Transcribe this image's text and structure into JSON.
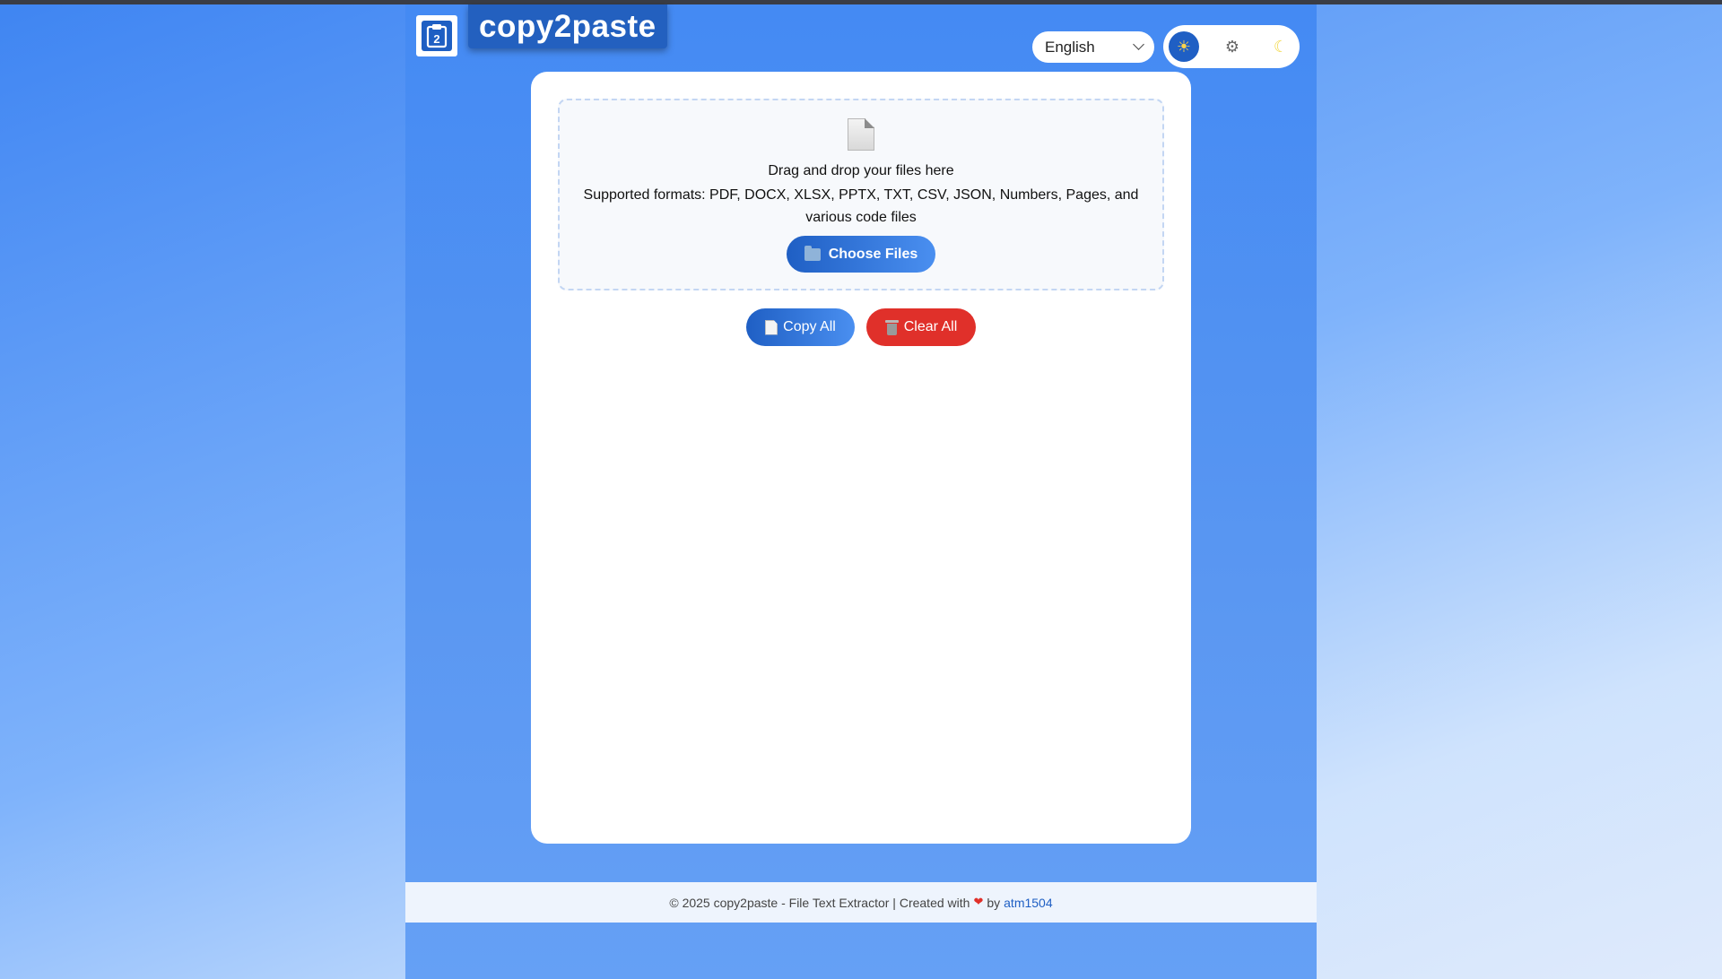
{
  "header": {
    "logo_text": "2",
    "brand": "copy2paste",
    "language": {
      "selected": "English"
    },
    "theme": {
      "options": [
        {
          "name": "light",
          "glyph": "☀",
          "active": true
        },
        {
          "name": "system",
          "glyph": "⚙",
          "active": false
        },
        {
          "name": "dark",
          "glyph": "☾",
          "active": false
        }
      ]
    }
  },
  "dropzone": {
    "title": "Drag and drop your files here",
    "formats": "Supported formats: PDF, DOCX, XLSX, PPTX, TXT, CSV, JSON, Numbers, Pages, and various code files",
    "choose_label": "Choose Files"
  },
  "actions": {
    "copy_label": "Copy All",
    "clear_label": "Clear All"
  },
  "footer": {
    "text": "© 2025 copy2paste - File Text Extractor | Created with",
    "heart": "❤",
    "by": "by",
    "author": "atm1504"
  },
  "colors": {
    "primary": "#1f5fc4",
    "danger": "#e0302a",
    "background": "#448af3"
  }
}
